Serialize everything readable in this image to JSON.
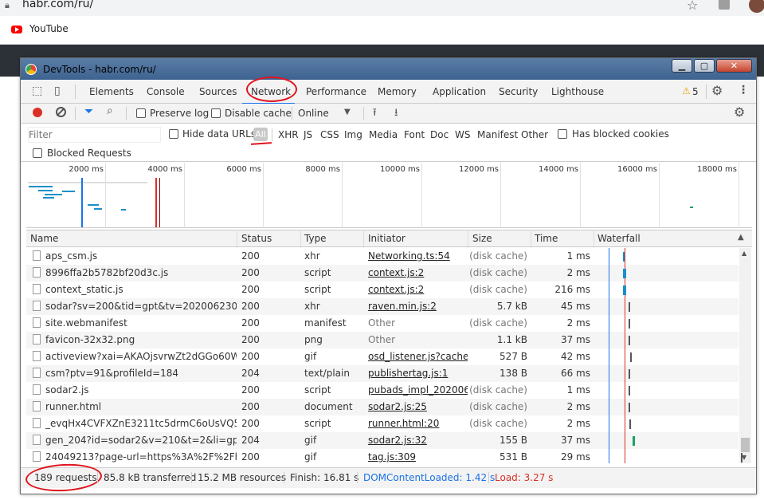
{
  "browser": {
    "url": "habr.com/ru/",
    "bookmark": "YouTube"
  },
  "devtools": {
    "title": "DevTools - habr.com/ru/",
    "window_buttons": {
      "min": "▁",
      "max": "▢",
      "close": "✕"
    },
    "tabs": [
      "Elements",
      "Console",
      "Sources",
      "Network",
      "Performance",
      "Memory",
      "Application",
      "Security",
      "Lighthouse"
    ],
    "active_tab": "Network",
    "warnings": "5",
    "toolbar": {
      "preserve_log": "Preserve log",
      "disable_cache": "Disable cache",
      "throttle": "Online"
    },
    "filter": {
      "placeholder": "Filter",
      "hide_data_urls": "Hide data URLs",
      "all": "All",
      "types": [
        "XHR",
        "JS",
        "CSS",
        "Img",
        "Media",
        "Font",
        "Doc",
        "WS",
        "Manifest",
        "Other"
      ],
      "has_blocked_cookies": "Has blocked cookies",
      "blocked_requests": "Blocked Requests"
    },
    "overview_ticks": [
      "2000 ms",
      "4000 ms",
      "6000 ms",
      "8000 ms",
      "10000 ms",
      "12000 ms",
      "14000 ms",
      "16000 ms",
      "18000 ms"
    ],
    "columns": [
      "Name",
      "Status",
      "Type",
      "Initiator",
      "Size",
      "Time",
      "Waterfall"
    ],
    "rows": [
      {
        "name": "aps_csm.js",
        "status": "200",
        "type": "xhr",
        "initiator": "Networking.ts:54",
        "init_link": true,
        "size": "(disk cache)",
        "time": "1 ms"
      },
      {
        "name": "8996ffa2b5782bf20d3c.js",
        "status": "200",
        "type": "script",
        "initiator": "context.js:2",
        "init_link": true,
        "size": "(disk cache)",
        "time": "2 ms"
      },
      {
        "name": "context_static.js",
        "status": "200",
        "type": "script",
        "initiator": "context.js:2",
        "init_link": true,
        "size": "(disk cache)",
        "time": "216 ms"
      },
      {
        "name": "sodar?sv=200&tid=gpt&tv=2020062301&...",
        "status": "200",
        "type": "xhr",
        "initiator": "raven.min.js:2",
        "init_link": true,
        "size": "5.7 kB",
        "time": "45 ms"
      },
      {
        "name": "site.webmanifest",
        "status": "200",
        "type": "manifest",
        "initiator": "Other",
        "init_link": false,
        "size": "(disk cache)",
        "time": "2 ms"
      },
      {
        "name": "favicon-32x32.png",
        "status": "200",
        "type": "png",
        "initiator": "Other",
        "init_link": false,
        "size": "1.1 kB",
        "time": "37 ms"
      },
      {
        "name": "activeview?xai=AKAOjsvrwZt2dGGo60WR...",
        "status": "200",
        "type": "gif",
        "initiator": "osd_listener.js?cache...",
        "init_link": true,
        "size": "527 B",
        "time": "42 ms"
      },
      {
        "name": "csm?ptv=91&profileId=184",
        "status": "204",
        "type": "text/plain",
        "initiator": "publishertag.js:1",
        "init_link": true,
        "size": "138 B",
        "time": "66 ms"
      },
      {
        "name": "sodar2.js",
        "status": "200",
        "type": "script",
        "initiator": "pubads_impl_202006...",
        "init_link": true,
        "size": "(disk cache)",
        "time": "1 ms"
      },
      {
        "name": "runner.html",
        "status": "200",
        "type": "document",
        "initiator": "sodar2.js:25",
        "init_link": true,
        "size": "(disk cache)",
        "time": "2 ms"
      },
      {
        "name": "_evqHx4CVFXZnE3211tc5drmC6oUsVQ5ur...",
        "status": "200",
        "type": "script",
        "initiator": "runner.html:20",
        "init_link": true,
        "size": "(disk cache)",
        "time": "2 ms"
      },
      {
        "name": "gen_204?id=sodar2&v=210&t=2&li=gpt_...",
        "status": "204",
        "type": "gif",
        "initiator": "sodar2.js:32",
        "init_link": true,
        "size": "155 B",
        "time": "37 ms"
      },
      {
        "name": "24049213?page-url=https%3A%2F%2Fhab...",
        "status": "200",
        "type": "gif",
        "initiator": "tag.js:309",
        "init_link": true,
        "size": "531 B",
        "time": "29 ms"
      }
    ],
    "status_bar": {
      "requests": "189 requests",
      "transferred": "85.8 kB transferred",
      "resources": "15.2 MB resources",
      "finish": "Finish: 16.81 s",
      "dcl": "DOMContentLoaded: 1.42 s",
      "load": "Load: 3.27 s"
    },
    "colors": {
      "dcl": "#1a73e8",
      "load": "#d93025",
      "accent": "#1a73e8",
      "annotation": "#e0141e"
    }
  }
}
